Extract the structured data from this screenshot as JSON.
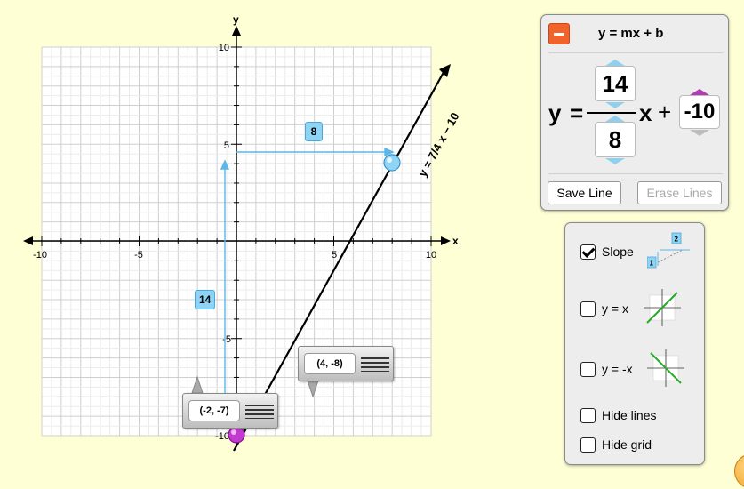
{
  "graph": {
    "x_axis_label": "x",
    "y_axis_label": "y",
    "x_tick_labels": [
      "-10",
      "-5",
      "5",
      "10"
    ],
    "y_tick_labels": [
      "10",
      "5",
      "-5",
      "-10"
    ],
    "x_range": [
      -10,
      10
    ],
    "y_range": [
      -10,
      10
    ],
    "line_equation_label": "y = 7/4 x − 10",
    "slope_rise": "14",
    "slope_run": "8",
    "point_a_label": "(-2, -7)",
    "point_b_label": "(4, -8)",
    "colors": {
      "line": "#000000",
      "slope_guides": "#5ab7e8",
      "intercept_handle": "#b424c0",
      "slope_handle": "#7cc8ee"
    }
  },
  "equation_panel": {
    "title": "y = mx + b",
    "y_label": "y",
    "equals": "=",
    "rise": "14",
    "run": "8",
    "x_label": "x",
    "plus": "+",
    "intercept": "-10",
    "save_label": "Save Line",
    "erase_label": "Erase Lines",
    "collapse_icon": "minus-icon",
    "accent": "#f2632a"
  },
  "options": {
    "slope_label": "Slope",
    "slope_checked": true,
    "y_eq_x_label": "y = x",
    "y_eq_x_checked": false,
    "y_eq_neg_x_label": "y = -x",
    "y_eq_neg_x_checked": false,
    "hide_lines_label": "Hide lines",
    "hide_lines_checked": false,
    "hide_grid_label": "Hide grid",
    "hide_grid_checked": false,
    "thumb_run": "2",
    "thumb_rise": "1"
  }
}
